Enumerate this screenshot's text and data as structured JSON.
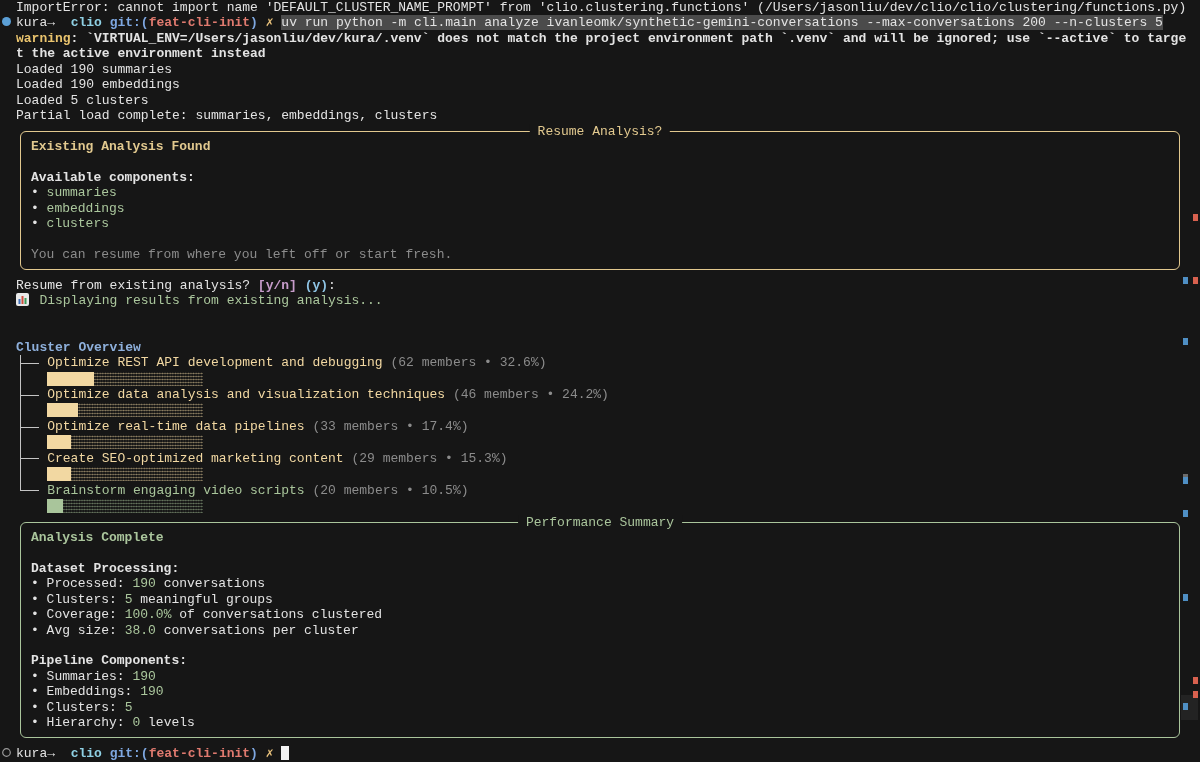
{
  "error_line": "ImportError: cannot import name 'DEFAULT_CLUSTER_NAME_PROMPT' from 'clio.clustering.functions' (/Users/jasonliu/dev/clio/clio/clustering/functions.py)",
  "command_prompt": {
    "finished": true,
    "user": "kura→",
    "directory": "clio",
    "git": {
      "prefix": "git:(",
      "branch": "feat-cli-init",
      "suffix": ")"
    },
    "dirty_mark": "✗",
    "command": "uv run python -m cli.main analyze ivanleomk/synthetic-gemini-conversations --max-conversations 200 --n-clusters 5",
    "selected": true
  },
  "warning": {
    "label": "warning",
    "text": ": `VIRTUAL_ENV=/Users/jasonliu/dev/kura/.venv` does not match the project environment path `.venv` and will be ignored; use `--active` to target the active environment instead"
  },
  "log_lines": [
    "Loaded 190 summaries",
    "Loaded 190 embeddings",
    "Loaded 5 clusters",
    "Partial load complete: summaries, embeddings, clusters"
  ],
  "resume_panel": {
    "title": "Resume Analysis?",
    "color": "#e2c98f",
    "heading": "Existing Analysis Found",
    "subheading": "Available components:",
    "components": [
      {
        "bullet": "•",
        "name": "summaries"
      },
      {
        "bullet": "•",
        "name": "embeddings"
      },
      {
        "bullet": "•",
        "name": "clusters"
      }
    ],
    "note": "You can resume from where you left off or start fresh."
  },
  "confirm_prompt": {
    "question": "Resume from existing analysis?",
    "choices": "[y/n]",
    "default": "(y)",
    "suffix": ":"
  },
  "status_message": {
    "text": "Displaying results from existing analysis..."
  },
  "cluster_overview": {
    "title": "Cluster Overview",
    "clusters": [
      {
        "name": "Optimize REST API development and debugging",
        "stats": "(62 members • 32.6%)",
        "level": 0.3,
        "color": "#f2d8a2"
      },
      {
        "name": "Optimize data analysis and visualization techniques",
        "stats": "(46 members • 24.2%)",
        "level": 0.2,
        "color": "#f2d8a2"
      },
      {
        "name": "Optimize real-time data pipelines",
        "stats": "(33 members • 17.4%)",
        "level": 0.15,
        "color": "#f2d8a2"
      },
      {
        "name": "Create SEO-optimized marketing content",
        "stats": "(29 members • 15.3%)",
        "level": 0.15,
        "color": "#f2d8a2"
      },
      {
        "name": "Brainstorm engaging video scripts",
        "stats": "(20 members • 10.5%)",
        "level": 0.1,
        "color": "#a9c59b"
      }
    ]
  },
  "summary_panel": {
    "title": "Performance Summary",
    "color": "#aac59c",
    "heading": "Analysis Complete",
    "sections": [
      {
        "title": "Dataset Processing:",
        "items": [
          {
            "bullet": "•",
            "label": "Processed:",
            "value": "190",
            "unit": "conversations"
          },
          {
            "bullet": "•",
            "label": "Clusters:",
            "value": "5",
            "unit": "meaningful groups"
          },
          {
            "bullet": "•",
            "label": "Coverage:",
            "value": "100.0%",
            "unit": "of conversations clustered"
          },
          {
            "bullet": "•",
            "label": "Avg size:",
            "value": "38.0",
            "unit": "conversations per cluster"
          }
        ]
      },
      {
        "title": "Pipeline Components:",
        "items": [
          {
            "bullet": "•",
            "label": "Summaries:",
            "value": "190"
          },
          {
            "bullet": "•",
            "label": "Embeddings:",
            "value": "190"
          },
          {
            "bullet": "•",
            "label": "Clusters:",
            "value": "5"
          },
          {
            "bullet": "•",
            "label": "Hierarchy:",
            "value": "0",
            "unit": "levels"
          }
        ]
      }
    ]
  },
  "shell_prompt": {
    "finished": false,
    "user": "kura→",
    "directory": "clio",
    "git": {
      "prefix": "git:(",
      "branch": "feat-cli-init",
      "suffix": ")"
    },
    "dirty_mark": "✗",
    "cursor": true
  }
}
